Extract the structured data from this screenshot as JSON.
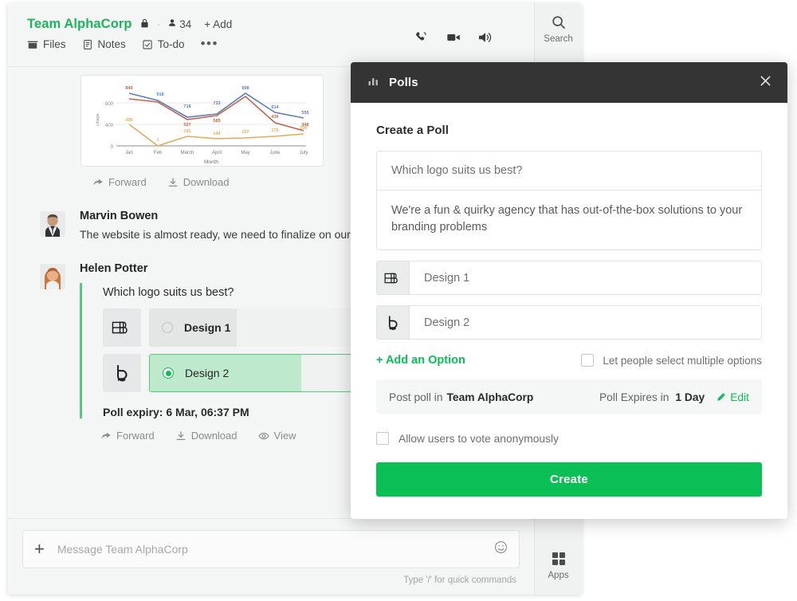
{
  "app": {
    "header": {
      "team_name": "Team AlphaCorp",
      "lock_icon": "lock-icon",
      "member_count": "34",
      "add_label": "+ Add",
      "tabs": [
        {
          "label": "Files",
          "icon": "files-icon"
        },
        {
          "label": "Notes",
          "icon": "notes-icon"
        },
        {
          "label": "To-do",
          "icon": "todo-icon"
        }
      ],
      "more_label": "•••",
      "actions": [
        {
          "name": "call-icon"
        },
        {
          "name": "video-icon"
        },
        {
          "name": "announcement-icon"
        }
      ]
    },
    "rail": {
      "search_label": "Search",
      "apps_label": "Apps"
    },
    "messages": {
      "attachment_actions": [
        {
          "label": "Forward",
          "icon": "forward-icon"
        },
        {
          "label": "Download",
          "icon": "download-icon"
        }
      ],
      "items": [
        {
          "name": "Marvin Bowen",
          "text": "The website is almost ready, we need to finalize on our lo"
        },
        {
          "name": "Helen Potter"
        }
      ],
      "poll": {
        "question": "Which logo suits us best?",
        "options": [
          {
            "label": "Design 1",
            "selected": false,
            "fill_pct": 38,
            "thumb": "logo-b-mark-icon"
          },
          {
            "label": "Design 2",
            "selected": true,
            "fill_pct": 66,
            "thumb": "logo-b-circle-icon"
          }
        ],
        "expiry": "Poll expiry: 6 Mar, 06:37 PM",
        "actions": [
          {
            "label": "Forward",
            "icon": "forward-icon"
          },
          {
            "label": "Download",
            "icon": "download-icon"
          },
          {
            "label": "View",
            "icon": "eye-icon"
          }
        ]
      }
    },
    "composer": {
      "placeholder": "Message Team AlphaCorp",
      "plus_icon": "plus-icon",
      "emoji_icon": "smiley-icon",
      "hint": "Type '/' for quick commands"
    }
  },
  "dialog": {
    "title": "Polls",
    "title_icon": "bar-chart-icon",
    "close_icon": "close-icon",
    "heading": "Create a Poll",
    "question_value": "Which logo suits us best?",
    "question_placeholder": "Which logo suits us best?",
    "description_value": "We're a fun & quirky agency that has out-of-the-box solutions to your branding problems",
    "options": [
      {
        "text": "Design 1",
        "placeholder": "Design 1",
        "thumb": "logo-b-mark-icon"
      },
      {
        "text": "Design 2",
        "placeholder": "Design 2",
        "thumb": "logo-b-circle-icon"
      }
    ],
    "add_option_label": "+ Add an Option",
    "multiple_label": "Let people select multiple options",
    "multiple_checked": false,
    "post_prefix": "Post poll in",
    "post_target": "Team AlphaCorp",
    "expires_prefix": "Poll Expires in",
    "expires_value": "1 Day",
    "edit_label": "Edit",
    "edit_icon": "pencil-icon",
    "anonymous_label": "Allow users to vote anonymously",
    "anonymous_checked": false,
    "create_label": "Create",
    "accent_color": "#0ABF53",
    "header_color": "#343434"
  },
  "chart_data": {
    "type": "line",
    "title": "",
    "xlabel": "Month",
    "ylabel": "Usage",
    "categories": [
      "Jan",
      "Feb",
      "March",
      "April",
      "May",
      "June",
      "July"
    ],
    "yticks": [
      0,
      400,
      800
    ],
    "ylim": [
      0,
      1000
    ],
    "grid": true,
    "legend": "none",
    "series": [
      {
        "name": "Series 1",
        "color": "#d4694f",
        "values": [
          849,
          918,
          527,
          585,
          908,
          439,
          348
        ],
        "labels": [
          "849",
          "918",
          "527",
          "585",
          "908",
          "439",
          "348"
        ]
      },
      {
        "name": "Series 2",
        "color": "#5b7fbc",
        "values": [
          960,
          918,
          718,
          733,
          908,
          614,
          555
        ],
        "labels": [
          "",
          "918",
          "718",
          "733",
          "",
          "614",
          "555"
        ]
      },
      {
        "name": "Series 3",
        "color": "#e8b45c",
        "values": [
          396,
          1,
          181,
          144,
          157,
          175,
          200
        ],
        "labels": [
          "396",
          "1",
          "181",
          "144",
          "157",
          "175",
          "200"
        ]
      }
    ]
  }
}
